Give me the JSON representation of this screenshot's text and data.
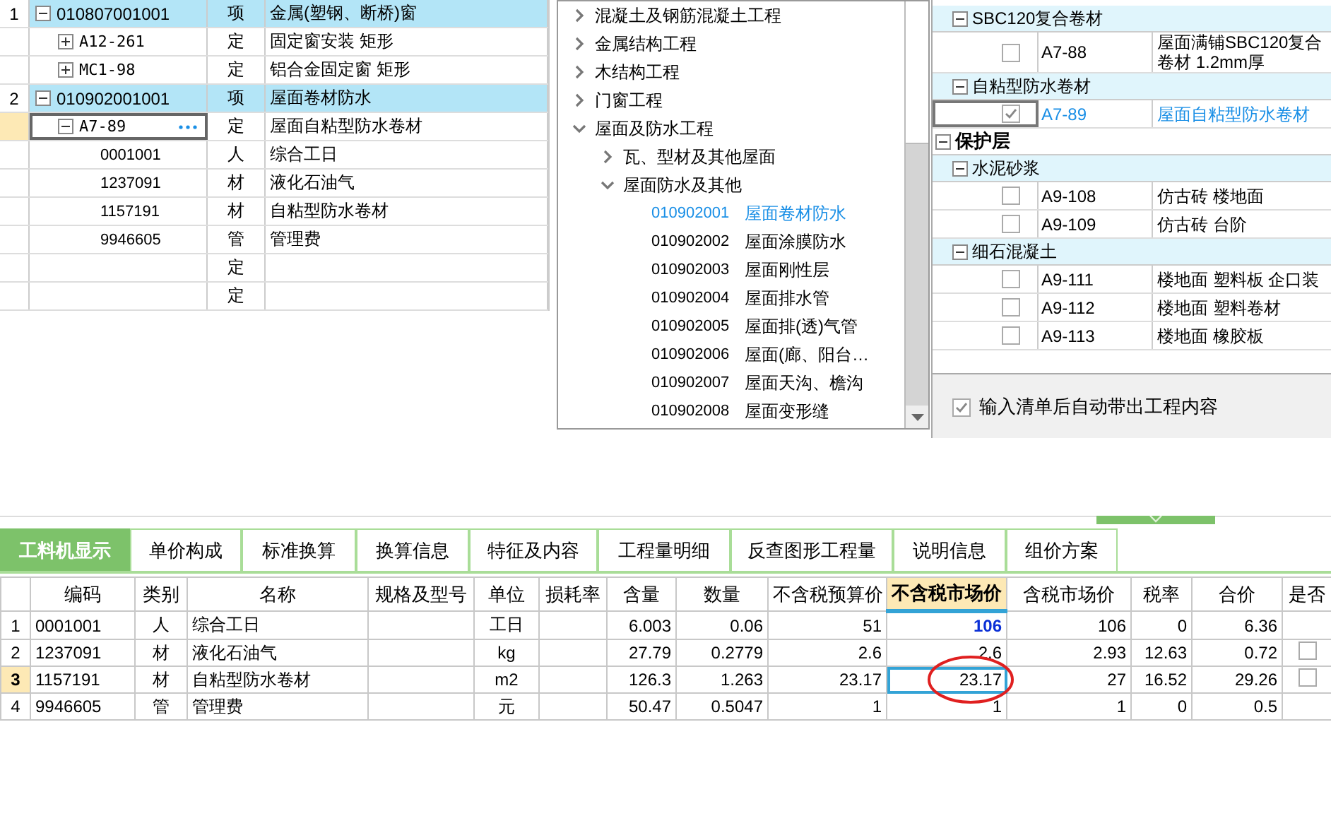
{
  "bill_tree": {
    "rows": [
      {
        "num": "1",
        "code": "010807001001",
        "type": "项",
        "name": "金属(塑钢、断桥)窗",
        "kind": "bill",
        "expanded": true,
        "selected": false,
        "children": [
          {
            "code": "A12-261",
            "type": "定",
            "name": "固定窗安装 矩形",
            "kind": "quota",
            "expanded": false,
            "selected": false
          },
          {
            "code": "MC1-98",
            "type": "定",
            "name": "铝合金固定窗 矩形",
            "kind": "quota",
            "expanded": false,
            "selected": false
          }
        ]
      },
      {
        "num": "2",
        "code": "010902001001",
        "type": "项",
        "name": "屋面卷材防水",
        "kind": "bill",
        "expanded": true,
        "selected": false,
        "children": [
          {
            "code": "A7-89",
            "type": "定",
            "name": "屋面自粘型防水卷材",
            "kind": "quota",
            "expanded": true,
            "selected": true,
            "children": [
              {
                "code": "0001001",
                "type": "人",
                "name": "综合工日",
                "kind": "resource",
                "selected": false
              },
              {
                "code": "1237091",
                "type": "材",
                "name": "液化石油气",
                "kind": "resource",
                "selected": false
              },
              {
                "code": "1157191",
                "type": "材",
                "name": "自粘型防水卷材",
                "kind": "resource",
                "selected": false
              },
              {
                "code": "9946605",
                "type": "管",
                "name": "管理费",
                "kind": "resource",
                "selected": false
              }
            ]
          },
          {
            "type": "定",
            "kind": "quota",
            "selected": false
          },
          {
            "type": "定",
            "kind": "quota",
            "selected": false
          }
        ]
      }
    ]
  },
  "chapter_tree": {
    "items": [
      {
        "label": "混凝土及钢筋混凝土工程",
        "expanded": false
      },
      {
        "label": "金属结构工程",
        "expanded": false
      },
      {
        "label": "木结构工程",
        "expanded": false
      },
      {
        "label": "门窗工程",
        "expanded": false
      },
      {
        "label": "屋面及防水工程",
        "expanded": true,
        "children": [
          {
            "label": "瓦、型材及其他屋面",
            "expanded": false
          },
          {
            "label": "屋面防水及其他",
            "expanded": true,
            "children": [
              {
                "code": "010902001",
                "name": "屋面卷材防水",
                "selected": true
              },
              {
                "code": "010902002",
                "name": "屋面涂膜防水",
                "selected": false
              },
              {
                "code": "010902003",
                "name": "屋面刚性层",
                "selected": false
              },
              {
                "code": "010902004",
                "name": "屋面排水管",
                "selected": false
              },
              {
                "code": "010902005",
                "name": "屋面排(透)气管",
                "selected": false
              },
              {
                "code": "010902006",
                "name": "屋面(廊、阳台…",
                "selected": false
              },
              {
                "code": "010902007",
                "name": "屋面天沟、檐沟",
                "selected": false
              },
              {
                "code": "010902008",
                "name": "屋面变形缝",
                "selected": false
              }
            ]
          }
        ]
      }
    ]
  },
  "quota_panel": {
    "tree": [
      {
        "kind": "group",
        "label": "SBC120复合卷材",
        "expanded": true,
        "children": [
          {
            "kind": "item",
            "code": "A7-88",
            "name": "屋面满铺SBC120复合卷材 1.2mm厚",
            "checked": false,
            "selected": false
          }
        ]
      },
      {
        "kind": "group",
        "label": "自粘型防水卷材",
        "expanded": true,
        "children": [
          {
            "kind": "item",
            "code": "A7-89",
            "name": "屋面自粘型防水卷材",
            "checked": true,
            "selected": true
          }
        ]
      },
      {
        "kind": "section",
        "label": "保护层",
        "expanded": true,
        "children": [
          {
            "kind": "group",
            "label": "水泥砂浆",
            "expanded": true,
            "children": [
              {
                "kind": "item",
                "code": "A9-108",
                "name": "仿古砖 楼地面",
                "checked": false,
                "selected": false
              },
              {
                "kind": "item",
                "code": "A9-109",
                "name": "仿古砖 台阶",
                "checked": false,
                "selected": false
              }
            ]
          },
          {
            "kind": "group",
            "label": "细石混凝土",
            "expanded": true,
            "children": [
              {
                "kind": "item",
                "code": "A9-111",
                "name": "楼地面 塑料板 企口装",
                "checked": false,
                "selected": false
              },
              {
                "kind": "item",
                "code": "A9-112",
                "name": "楼地面 塑料卷材",
                "checked": false,
                "selected": false
              },
              {
                "kind": "item",
                "code": "A9-113",
                "name": "楼地面 橡胶板",
                "checked": false,
                "selected": false
              }
            ]
          }
        ]
      }
    ],
    "auto_option": {
      "label": "输入清单后自动带出工程内容",
      "checked": true
    }
  },
  "detail_tabs": [
    {
      "label": "工料机显示",
      "selected": true
    },
    {
      "label": "单价构成",
      "selected": false
    },
    {
      "label": "标准换算",
      "selected": false
    },
    {
      "label": "换算信息",
      "selected": false
    },
    {
      "label": "特征及内容",
      "selected": false
    },
    {
      "label": "工程量明细",
      "selected": false
    },
    {
      "label": "反查图形工程量",
      "selected": false
    },
    {
      "label": "说明信息",
      "selected": false
    },
    {
      "label": "组价方案",
      "selected": false
    }
  ],
  "resource_table": {
    "columns": [
      {
        "label": "编码",
        "selected": false
      },
      {
        "label": "类别",
        "selected": false
      },
      {
        "label": "名称",
        "selected": false
      },
      {
        "label": "规格及型号",
        "selected": false
      },
      {
        "label": "单位",
        "selected": false
      },
      {
        "label": "损耗率",
        "selected": false
      },
      {
        "label": "含量",
        "selected": false
      },
      {
        "label": "数量",
        "selected": false
      },
      {
        "label": "不含税预算价",
        "selected": false
      },
      {
        "label": "不含税市场价",
        "selected": true
      },
      {
        "label": "含税市场价",
        "selected": false
      },
      {
        "label": "税率",
        "selected": false
      },
      {
        "label": "合价",
        "selected": false
      },
      {
        "label": "是否",
        "selected": false
      }
    ],
    "rows": [
      {
        "num": "1",
        "cells": [
          "0001001",
          "人",
          "综合工日",
          "",
          "工日",
          "",
          "6.003",
          "0.06",
          "51",
          "106",
          "106",
          "0",
          "6.36"
        ],
        "selected": false,
        "edited": true
      },
      {
        "num": "2",
        "cells": [
          "1237091",
          "材",
          "液化石油气",
          "",
          "kg",
          "",
          "27.79",
          "0.2779",
          "2.6",
          "2.6",
          "2.93",
          "12.63",
          "0.72"
        ],
        "selected": false,
        "flag": {
          "checked": false
        }
      },
      {
        "num": "3",
        "cells": [
          "1157191",
          "材",
          "自粘型防水卷材",
          "",
          "m2",
          "",
          "126.3",
          "1.263",
          "23.17",
          "23.17",
          "27",
          "16.52",
          "29.26"
        ],
        "selected": true,
        "active": true,
        "circled": true,
        "flag": {
          "checked": false
        }
      },
      {
        "num": "4",
        "cells": [
          "9946605",
          "管",
          "管理费",
          "",
          "元",
          "",
          "50.47",
          "0.5047",
          "1",
          "1",
          "1",
          "0",
          "0.5"
        ],
        "selected": false
      }
    ]
  }
}
